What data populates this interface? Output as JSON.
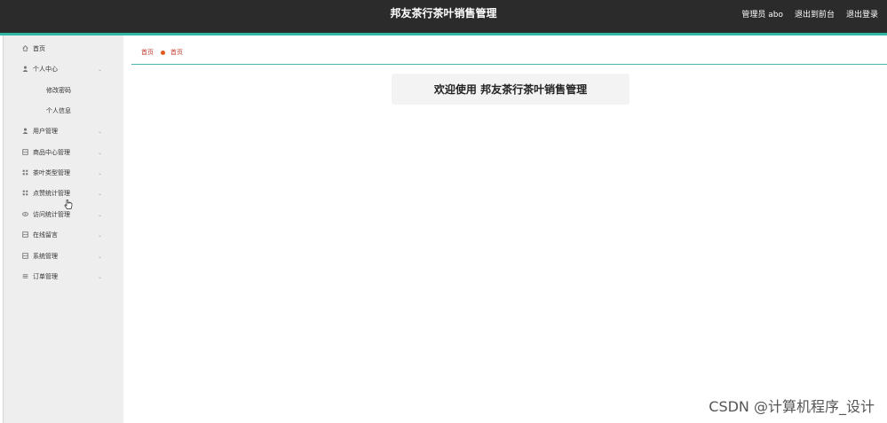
{
  "header": {
    "title": "邦友茶行茶叶销售管理",
    "admin_label": "管理员 abo",
    "exit_front": "退出到前台",
    "logout": "退出登录"
  },
  "sidebar": {
    "items": [
      {
        "label": "首页",
        "icon": "home-icon",
        "has_chevron": false
      },
      {
        "label": "个人中心",
        "icon": "user-icon",
        "has_chevron": true,
        "children": [
          "修改密码",
          "个人信息"
        ]
      },
      {
        "label": "用户管理",
        "icon": "user-icon",
        "has_chevron": true
      },
      {
        "label": "商品中心管理",
        "icon": "grid-icon",
        "has_chevron": true
      },
      {
        "label": "茶叶类型管理",
        "icon": "grid-icon",
        "has_chevron": true
      },
      {
        "label": "点赞统计管理",
        "icon": "grid-icon",
        "has_chevron": true
      },
      {
        "label": "访问统计管理",
        "icon": "eye-icon",
        "has_chevron": true
      },
      {
        "label": "在线留言",
        "icon": "grid-icon",
        "has_chevron": true
      },
      {
        "label": "系统管理",
        "icon": "grid-icon",
        "has_chevron": true
      },
      {
        "label": "订单管理",
        "icon": "list-icon",
        "has_chevron": true
      }
    ]
  },
  "breadcrumb": {
    "first": "首页",
    "current": "首页"
  },
  "main": {
    "welcome": "欢迎使用 邦友茶行茶叶销售管理"
  },
  "watermark": "CSDN @计算机程序_设计",
  "colors": {
    "topbar": "#2b2b2b",
    "accent": "#2fb5a3",
    "breadcrumb_text": "#c0392b",
    "breadcrumb_dot": "#e05a1a",
    "sidebar_bg": "#eeeeee"
  }
}
